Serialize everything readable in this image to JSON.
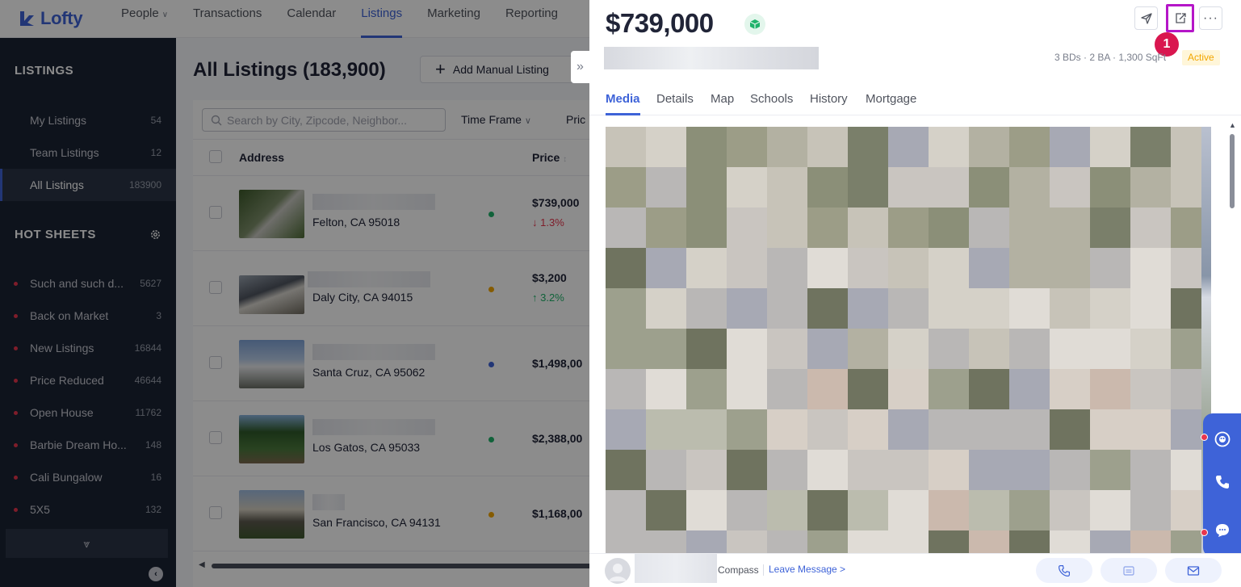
{
  "topnav": {
    "brand": "Lofty",
    "items": [
      {
        "label": "People",
        "has_dropdown": true
      },
      {
        "label": "Transactions"
      },
      {
        "label": "Calendar"
      },
      {
        "label": "Listings",
        "active": true
      },
      {
        "label": "Marketing"
      },
      {
        "label": "Reporting"
      }
    ]
  },
  "sidebar": {
    "listings_heading": "LISTINGS",
    "listings": [
      {
        "label": "My Listings",
        "count": "54"
      },
      {
        "label": "Team Listings",
        "count": "12"
      },
      {
        "label": "All Listings",
        "count": "183900",
        "active": true
      }
    ],
    "hot_sheets_heading": "HOT SHEETS",
    "hot_sheets": [
      {
        "label": "Such and such d...",
        "count": "5627"
      },
      {
        "label": "Back on Market",
        "count": "3"
      },
      {
        "label": "New Listings",
        "count": "16844"
      },
      {
        "label": "Price Reduced",
        "count": "46644"
      },
      {
        "label": "Open House",
        "count": "11762"
      },
      {
        "label": "Barbie Dream Ho...",
        "count": "148"
      },
      {
        "label": "Cali Bungalow",
        "count": "16"
      },
      {
        "label": "5X5",
        "count": "132"
      }
    ],
    "more_icon": "double-chevron-down",
    "collapse_icon": "chevron-left"
  },
  "main": {
    "title": "All Listings (183,900)",
    "add_button": "Add Manual Listing",
    "search_placeholder": "Search by City, Zipcode, Neighbor...",
    "filters": {
      "time_frame": "Time Frame",
      "price": "Pric"
    },
    "columns": {
      "address": "Address",
      "price": "Price"
    },
    "rows": [
      {
        "city": "Felton, CA 95018",
        "price": "$739,000",
        "change": "1.3%",
        "direction": "down",
        "status_color": "#1fb36b"
      },
      {
        "city": "Daly City, CA 94015",
        "price": "$3,200",
        "change": "3.2%",
        "direction": "up",
        "status_color": "#f2a600"
      },
      {
        "city": "Santa Cruz, CA 95062",
        "price": "$1,498,00",
        "status_color": "#3e63d8"
      },
      {
        "city": "Los Gatos, CA 95033",
        "price": "$2,388,00",
        "status_color": "#1fb36b"
      },
      {
        "city": "San Francisco, CA 94131",
        "price": "$1,168,00",
        "status_color": "#f2a600"
      }
    ]
  },
  "drawer": {
    "price": "$739,000",
    "specs": "3 BDs · 2 BA · 1,300 SqFt",
    "status": "Active",
    "step_marker": "1",
    "header_icons": [
      "send-icon",
      "share-icon",
      "more-icon"
    ],
    "tabs": [
      "Media",
      "Details",
      "Map",
      "Schools",
      "History",
      "Mortgage"
    ],
    "active_tab": "Media",
    "footer": {
      "company": "Compass",
      "leave_message": "Leave Message >"
    }
  },
  "colors": {
    "accent": "#3e63d8",
    "highlight": "#b516c8",
    "step_badge": "#d9164f",
    "sidebar_bg": "#1b2334",
    "status_active": "#f2a600"
  }
}
